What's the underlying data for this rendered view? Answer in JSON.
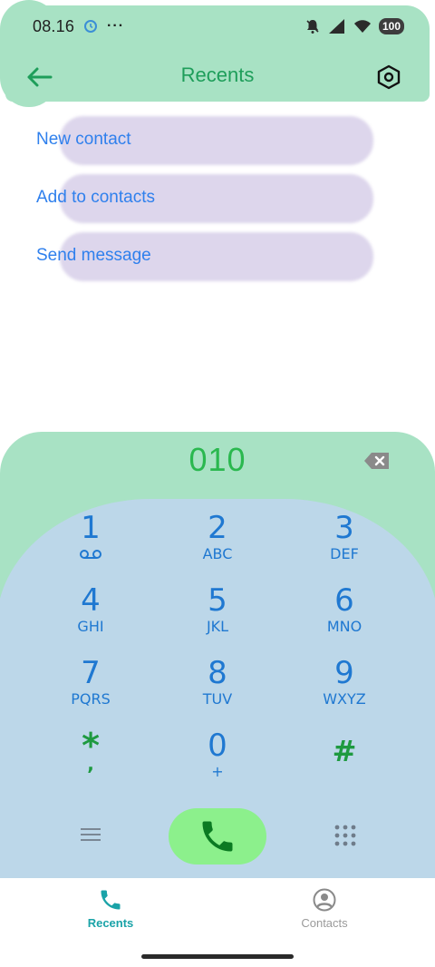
{
  "status_bar": {
    "time": "08.16",
    "dots": "···",
    "battery": "100"
  },
  "app_bar": {
    "title": "Recents"
  },
  "actions": [
    {
      "label": "New contact"
    },
    {
      "label": "Add to contacts"
    },
    {
      "label": "Send message"
    }
  ],
  "dialer": {
    "number": "010",
    "keys": [
      {
        "digit": "1",
        "letters": ""
      },
      {
        "digit": "2",
        "letters": "ABC"
      },
      {
        "digit": "3",
        "letters": "DEF"
      },
      {
        "digit": "4",
        "letters": "GHI"
      },
      {
        "digit": "5",
        "letters": "JKL"
      },
      {
        "digit": "6",
        "letters": "MNO"
      },
      {
        "digit": "7",
        "letters": "PQRS"
      },
      {
        "digit": "8",
        "letters": "TUV"
      },
      {
        "digit": "9",
        "letters": "WXYZ"
      },
      {
        "digit": "*",
        "letters": ","
      },
      {
        "digit": "0",
        "letters": "+"
      },
      {
        "digit": "#",
        "letters": ""
      }
    ]
  },
  "bottom_nav": {
    "recents": "Recents",
    "contacts": "Contacts"
  },
  "colors": {
    "accent_green": "#1e9e5a",
    "mint": "#a8e2c4",
    "keypad_blue": "#bcd7e9",
    "link_blue": "#2f80ed",
    "call_green": "#8cf08c"
  },
  "icons": {
    "back": "arrow-left-icon",
    "settings": "hexagon-settings-icon",
    "backspace": "backspace-icon",
    "voicemail": "voicemail-icon",
    "menu": "menu-icon",
    "call": "phone-icon",
    "keypad": "dialpad-icon",
    "recents_tab": "phone-icon",
    "contacts_tab": "account-circle-icon"
  }
}
